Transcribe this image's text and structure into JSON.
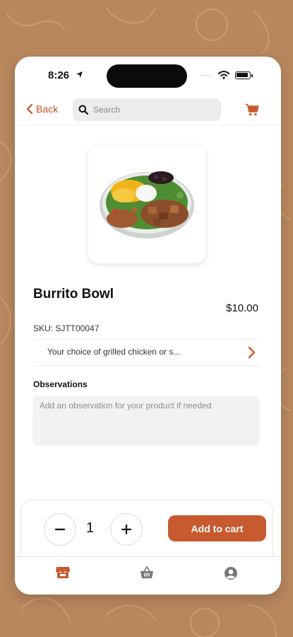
{
  "status_bar": {
    "time": "8:26",
    "signal_dots": "....",
    "icons": [
      "location-arrow-icon",
      "wifi-icon",
      "battery-icon"
    ]
  },
  "header": {
    "back_label": "Back",
    "search_placeholder": "Search",
    "search_value": "",
    "cart_icon": "cart-icon"
  },
  "product": {
    "image": "burrito-bowl-photo",
    "name": "Burrito Bowl",
    "price": "$10.00",
    "sku": "SKU: SJTT00047",
    "description_preview": "Your choice of grilled chicken or s..."
  },
  "observations": {
    "label": "Observations",
    "placeholder": "Add an observation for your product if needed",
    "value": ""
  },
  "cart_controls": {
    "quantity": "1",
    "add_label": "Add to cart"
  },
  "tab_bar": {
    "tabs": [
      {
        "icon": "store-icon",
        "active": true
      },
      {
        "icon": "basket-icon",
        "active": false
      },
      {
        "icon": "profile-icon",
        "active": false
      }
    ]
  },
  "colors": {
    "accent": "#c85a30",
    "back_link": "#d04a24",
    "background": "#b8875e"
  }
}
